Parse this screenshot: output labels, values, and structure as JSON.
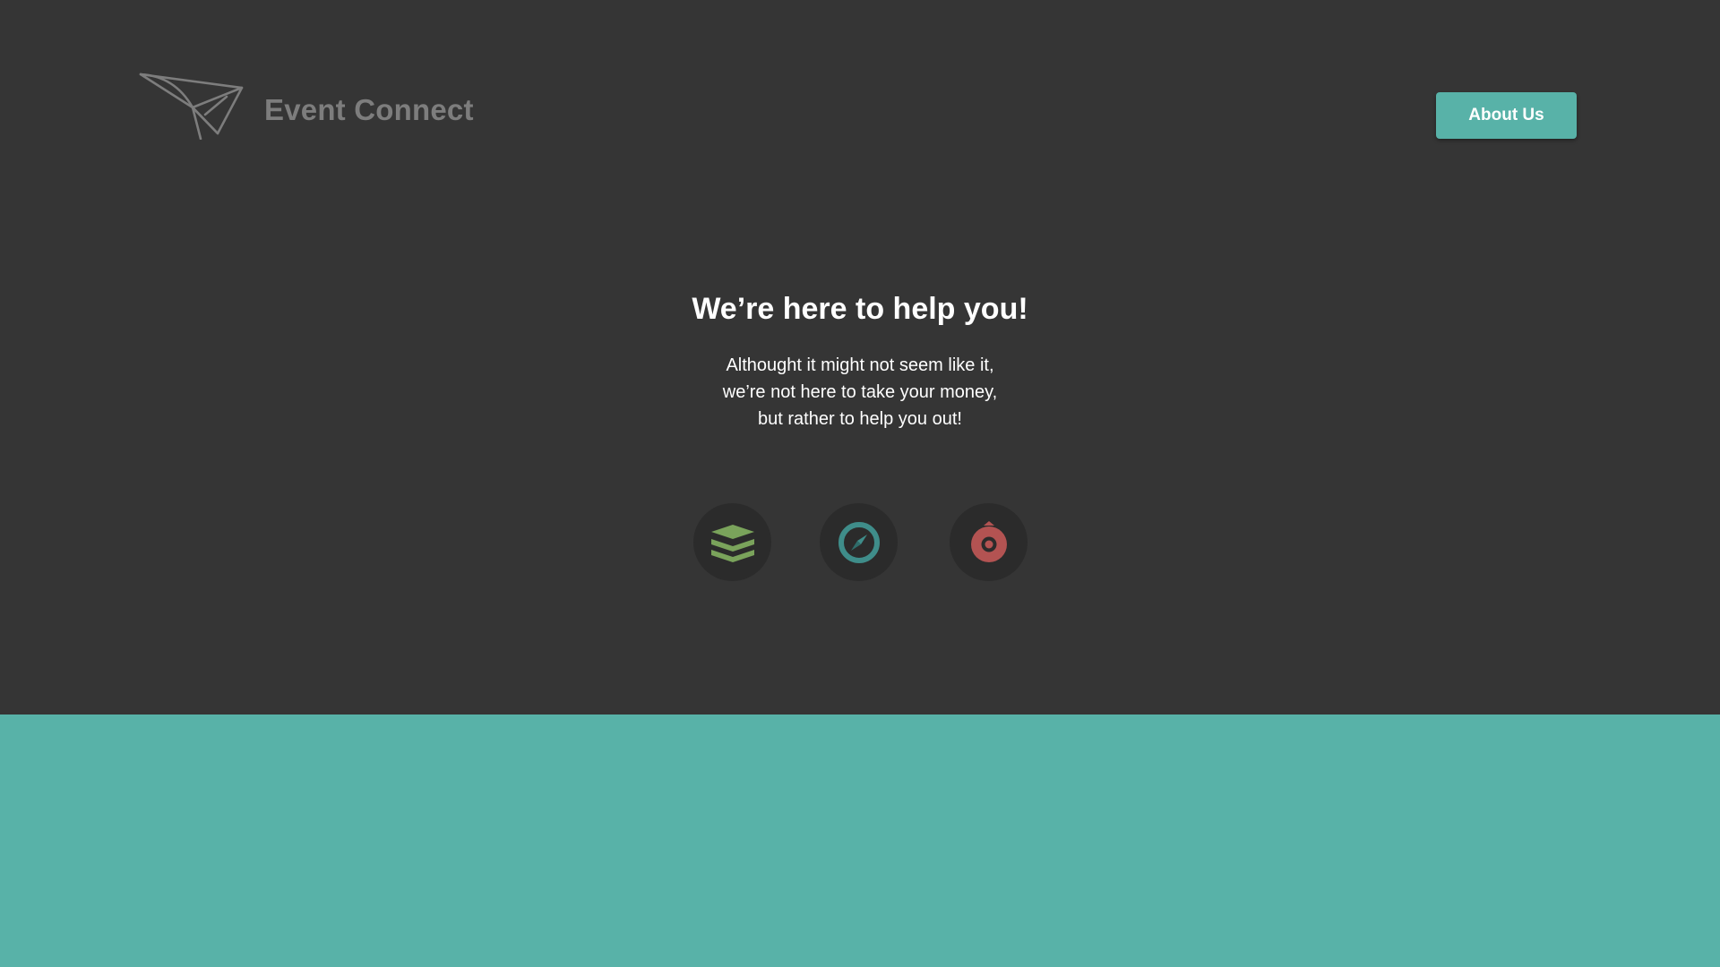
{
  "header": {
    "brand_name": "Event Connect",
    "logo_icon": "paper-plane-icon",
    "about_button_label": "About Us"
  },
  "hero": {
    "headline": "We’re here to help you!",
    "subtext_lines": [
      "Althought it might not seem like it,",
      "we’re not here to take your money,",
      "but rather to help you out!"
    ]
  },
  "features": [
    {
      "icon": "layers-stack-icon",
      "color": "#7aa35b"
    },
    {
      "icon": "compass-icon",
      "color": "#3f8d8a"
    },
    {
      "icon": "target-badge-icon",
      "color": "#b35352"
    }
  ],
  "colors": {
    "background_dark": "#353535",
    "accent_teal": "#58b2a8",
    "brand_text": "#7d7d7d",
    "icon_circle": "#2b2b2b"
  }
}
